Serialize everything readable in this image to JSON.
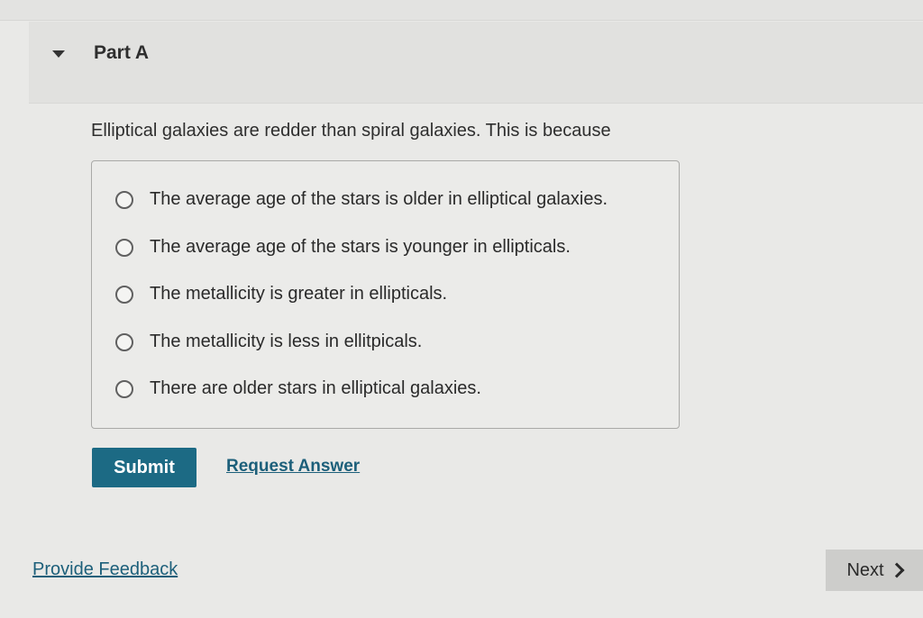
{
  "part": {
    "title": "Part A",
    "toggle_icon": "caret-down-icon"
  },
  "question": {
    "prompt": "Elliptical galaxies are redder than spiral galaxies. This is because",
    "options": [
      "The average age of the stars is older in elliptical galaxies.",
      "The average age of the stars is younger in ellipticals.",
      "The metallicity is greater in ellipticals.",
      "The metallicity is less in ellitpicals.",
      "There are older stars in elliptical galaxies."
    ]
  },
  "actions": {
    "submit_label": "Submit",
    "request_answer_label": "Request Answer"
  },
  "footer": {
    "feedback_label": "Provide Feedback",
    "next_label": "Next",
    "next_icon": "chevron-right-icon"
  },
  "colors": {
    "submit_bg": "#1c6a84",
    "link": "#1c5f7a",
    "next_bg": "#cdcdcb"
  }
}
